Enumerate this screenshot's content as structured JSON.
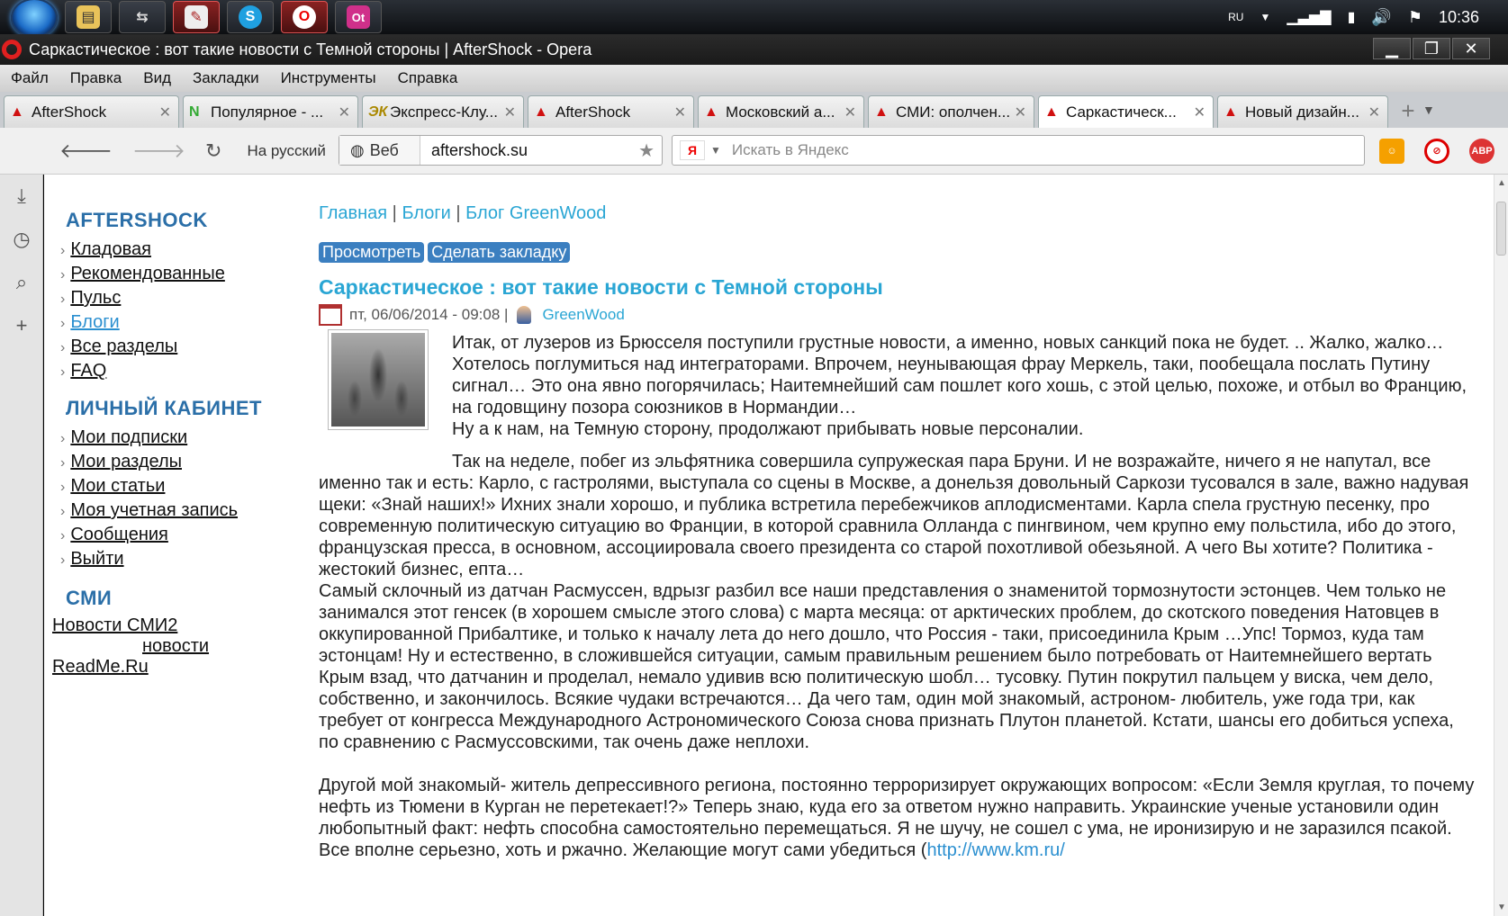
{
  "taskbar": {
    "apps": [
      {
        "name": "explorer",
        "glyph": "▤"
      },
      {
        "name": "network",
        "glyph": "⇆"
      },
      {
        "name": "tool",
        "glyph": "✎"
      },
      {
        "name": "skype",
        "glyph": "S"
      },
      {
        "name": "opera",
        "glyph": "O"
      },
      {
        "name": "odnoklassniki",
        "glyph": "Ot"
      }
    ],
    "lang": "RU",
    "clock": "10:36"
  },
  "window": {
    "title": "Саркастическое : вот такие новости с Темной стороны | AfterShock - Opera"
  },
  "menu": [
    "Файл",
    "Правка",
    "Вид",
    "Закладки",
    "Инструменты",
    "Справка"
  ],
  "tabs": [
    {
      "label": "AfterShock",
      "icon": "A"
    },
    {
      "label": "Популярное - ...",
      "icon": "N"
    },
    {
      "label": "Экспресс-Клу...",
      "icon": "ЭК"
    },
    {
      "label": "AfterShock",
      "icon": "A"
    },
    {
      "label": "Московский а...",
      "icon": "A"
    },
    {
      "label": "СМИ: ополчен...",
      "icon": "A"
    },
    {
      "label": "Саркастическ...",
      "icon": "A"
    },
    {
      "label": "Новый дизайн...",
      "icon": "A"
    }
  ],
  "nav": {
    "translate": "На русский",
    "web_label": "Веб",
    "url": "aftershock.su",
    "search_placeholder": "Искать в Яндекс",
    "search_engine": "Я",
    "abp": "ABP"
  },
  "sidebar": {
    "heading1": "AFTERSHOCK",
    "links1": [
      "Кладовая",
      "Рекомендованные",
      "Пульс",
      "Блоги",
      "Все разделы",
      "FAQ"
    ],
    "heading2": "ЛИЧНЫЙ КАБИНЕТ",
    "links2": [
      "Мои подписки",
      "Мои разделы",
      "Мои статьи",
      "Моя учетная запись",
      "Сообщения",
      "Выйти"
    ],
    "heading3": "СМИ",
    "smi1": "Новости СМИ2",
    "smi2": "новости",
    "smi3": "ReadMe.Ru"
  },
  "crumbs": [
    "Главная",
    "Блоги",
    "Блог GreenWood"
  ],
  "buttons": {
    "view": "Просмотреть",
    "bookmark": "Сделать закладку"
  },
  "post": {
    "title": "Саркастическое : вот такие новости с Темной стороны",
    "date": "пт, 06/06/2014 - 09:08 |",
    "author": "GreenWood",
    "p1": "Итак, от лузеров из Брюсселя поступили грустные новости, а именно, новых санкций пока не будет. .. Жалко, жалко… Хотелось поглумиться над интеграторами. Впрочем, неунывающая фрау Меркель, таки, пообещала послать Путину сигнал… Это она явно погорячилась; Наитемнейший сам пошлет кого хошь, с этой целью, похоже, и отбыл во Францию, на годовщину позора союзников в Нормандии…",
    "p1b": "Ну а к нам, на Темную сторону, продолжают прибывать новые персоналии.",
    "p2": "Так на неделе, побег из эльфятника совершила супружеская пара Бруни. И не возражайте, ничего я не напутал, все именно так и есть: Карло, с гастролями, выступала со сцены в Москве, а донельзя довольный Саркози тусовался в зале, важно надувая щеки: «Знай наших!» Ихних знали хорошо, и публика встретила перебежчиков аплодисментами. Карла спела грустную песенку, про современную политическую ситуацию во Франции, в которой сравнила Олланда с пингвином, чем крупно ему польстила, ибо до этого, французская пресса, в основном, ассоциировала своего президента со старой похотливой обезьяной. А чего Вы хотите? Политика - жестокий бизнес, епта…",
    "p3": "Самый склочный из датчан Расмуссен, вдрызг разбил все наши представления о знаменитой тормознутости эстонцев. Чем только не занимался этот генсек (в хорошем смысле этого слова) с марта месяца: от арктических проблем, до скотского поведения Натовцев в оккупированной Прибалтике, и только к началу лета до него дошло, что Россия - таки, присоединила Крым …Упс! Тормоз, куда там эстонцам! Ну и естественно, в сложившейся ситуации, самым правильным решением было потребовать от Наитемнейшего вертать Крым взад, что датчанин и проделал, немало удивив всю политическую шобл… тусовку. Путин покрутил пальцем у виска, чем дело, собственно, и закончилось. Всякие чудаки встречаются… Да чего там, один мой знакомый, астроном- любитель, уже года три, как требует от конгресса Международного Астрономического Союза снова признать Плутон планетой. Кстати, шансы его добиться успеха, по сравнению с Расмуссовскими, так очень даже неплохи.",
    "p4": "Другой мой знакомый- житель депрессивного региона, постоянно терроризирует окружающих вопросом: «Если Земля круглая, то почему нефть из Тюмени в Курган не перетекает!?» Теперь знаю, куда его за ответом нужно направить. Украинские ученые установили один любопытный факт: нефть способна самостоятельно перемещаться. Я не шучу, не сошел с ума, не иронизирую и не заразился псакой. Все вполне серьезно, хоть и ржачно. Желающие могут сами убедиться (",
    "p4link": "http://www.km.ru/"
  },
  "colors": {
    "link": "#2aa6d4",
    "heading": "#2b6fa8",
    "button": "#3b7fc0",
    "opera_red": "#e02020"
  }
}
